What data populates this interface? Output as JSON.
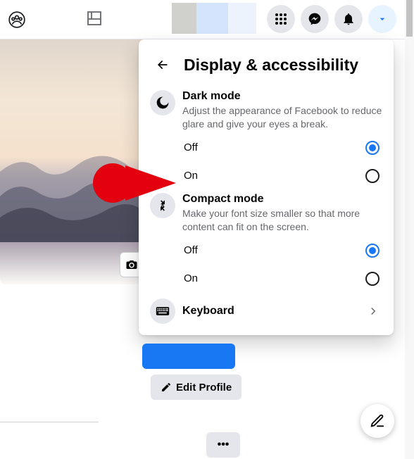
{
  "dropdown": {
    "title": "Display & accessibility",
    "dark_mode": {
      "title": "Dark mode",
      "desc": "Adjust the appearance of Facebook to reduce glare and give your eyes a break.",
      "options": {
        "off": "Off",
        "on": "On"
      },
      "selected": "off"
    },
    "compact_mode": {
      "title": "Compact mode",
      "desc": "Make your font size smaller so that more content can fit on the screen.",
      "options": {
        "off": "Off",
        "on": "On"
      },
      "selected": "off"
    },
    "keyboard": {
      "label": "Keyboard"
    }
  },
  "profile": {
    "edit_label": "Edit Profile",
    "more_label": "•••"
  }
}
